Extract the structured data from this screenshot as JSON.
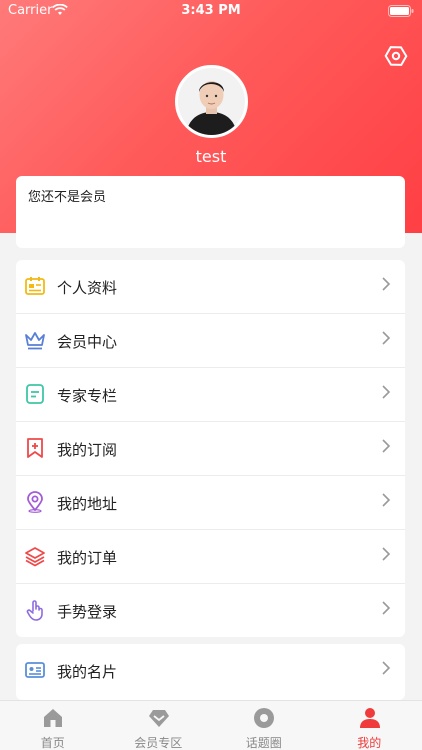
{
  "status_bar": {
    "carrier": "Carrier",
    "time": "3:43 PM"
  },
  "profile": {
    "username": "test",
    "settings_icon": "settings-hexagon-icon",
    "avatar_icon": "avatar-photo"
  },
  "member_card": {
    "text": "您还不是会员"
  },
  "menu_group_1": [
    {
      "label": "个人资料",
      "icon": "id-card-icon",
      "color": "#f3b914"
    },
    {
      "label": "会员中心",
      "icon": "crown-icon",
      "color": "#5a7fd8"
    },
    {
      "label": "专家专栏",
      "icon": "notes-icon",
      "color": "#3ec6a6"
    },
    {
      "label": "我的订阅",
      "icon": "bookmark-plus-icon",
      "color": "#ef4a4a"
    },
    {
      "label": "我的地址",
      "icon": "location-pin-icon",
      "color": "#a35cd6"
    },
    {
      "label": "我的订单",
      "icon": "layers-icon",
      "color": "#ef4a4a"
    },
    {
      "label": "手势登录",
      "icon": "hand-gesture-icon",
      "color": "#8d6ce0"
    }
  ],
  "menu_group_2": [
    {
      "label": "我的名片",
      "icon": "business-card-icon",
      "color": "#5a8ed8"
    }
  ],
  "tabs": [
    {
      "label": "首页",
      "icon": "home-icon",
      "active": false
    },
    {
      "label": "会员专区",
      "icon": "diamond-icon",
      "active": false
    },
    {
      "label": "话题圈",
      "icon": "topic-circle-icon",
      "active": false
    },
    {
      "label": "我的",
      "icon": "person-icon",
      "active": true
    }
  ],
  "colors": {
    "header_start": "#ff7a7a",
    "header_end": "#ff3f44",
    "accent": "#ef3b3b"
  }
}
